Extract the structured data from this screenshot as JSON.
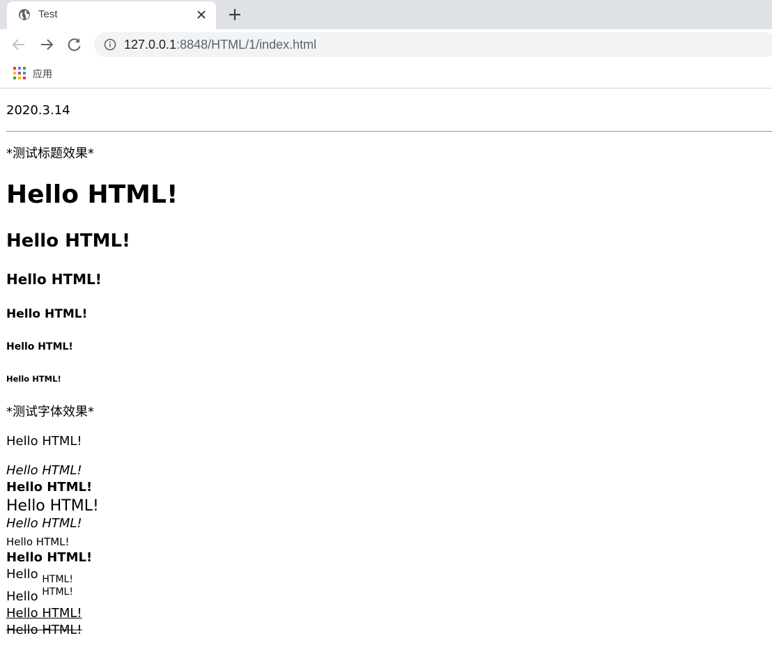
{
  "browser": {
    "tab": {
      "title": "Test",
      "favicon": "globe-icon",
      "close": "close-icon"
    },
    "new_tab": "plus-icon",
    "toolbar": {
      "back": "arrow-left-icon",
      "forward": "arrow-right-icon",
      "reload": "reload-icon",
      "info": "info-icon",
      "url_host": "127.0.0.1",
      "url_rest": ":8848/HTML/1/index.html"
    },
    "bookmarks": {
      "apps_label": "应用",
      "apps_icon": "apps-grid-icon"
    }
  },
  "page": {
    "date": "2020.3.14",
    "heading_section_label": "*测试标题效果*",
    "headings": {
      "h1": "Hello HTML!",
      "h2": "Hello HTML!",
      "h3": "Hello HTML!",
      "h4": "Hello HTML!",
      "h5": "Hello HTML!",
      "h6": "Hello HTML!"
    },
    "font_section_label": "*测试字体效果*",
    "font_lines": {
      "plain": "Hello HTML!",
      "italic": "Hello HTML!",
      "bold": "Hello HTML!",
      "big": "Hello HTML!",
      "emphasis": "Hello HTML!",
      "small": "Hello HTML!",
      "strong": "Hello HTML!",
      "sub_base": "Hello",
      "sub_text": "HTML!",
      "sup_base": "Hello",
      "sup_text": "HTML!",
      "underline": "Hello HTML!",
      "strike": "Hello HTML!"
    }
  }
}
